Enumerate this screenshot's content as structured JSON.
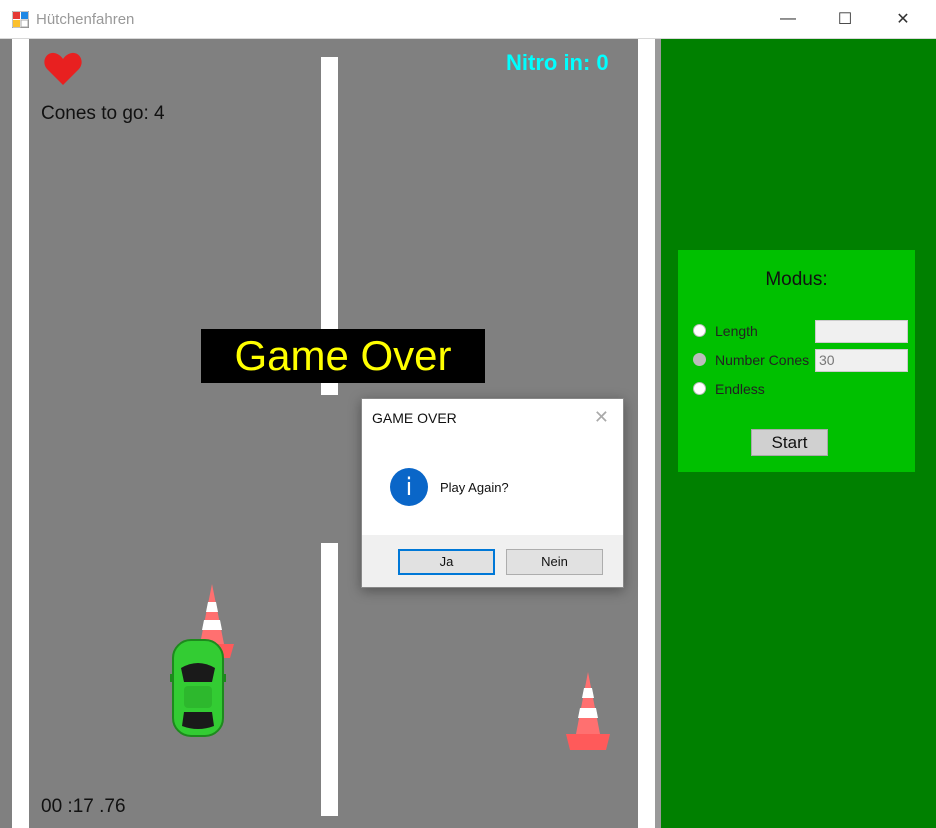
{
  "window": {
    "title": "Hütchenfahren",
    "minimize_glyph": "—",
    "maximize_glyph": "☐",
    "close_glyph": "✕"
  },
  "hud": {
    "lives": 1,
    "cones_to_go_label": "Cones to go: 4",
    "nitro_label": "Nitro in: 0",
    "game_over_text": "Game Over",
    "timer": "00 :17 .76"
  },
  "settings_panel": {
    "title": "Modus:",
    "options": [
      {
        "label": "Length",
        "selected": false,
        "value": ""
      },
      {
        "label": "Number Cones",
        "selected": true,
        "value": "30"
      },
      {
        "label": "Endless",
        "selected": false
      }
    ],
    "start_label": "Start"
  },
  "dialog": {
    "title": "GAME OVER",
    "close_glyph": "✕",
    "icon": "info-icon",
    "icon_glyph": "i",
    "message": "Play Again?",
    "yes_label": "Ja",
    "no_label": "Nein"
  },
  "colors": {
    "road": "#808080",
    "panel": "#008000",
    "mode_box": "#00c000",
    "nitro": "#00ffff",
    "game_over_text": "#ffff00",
    "car": "#33cc33",
    "cone": "#ff6b6b"
  }
}
